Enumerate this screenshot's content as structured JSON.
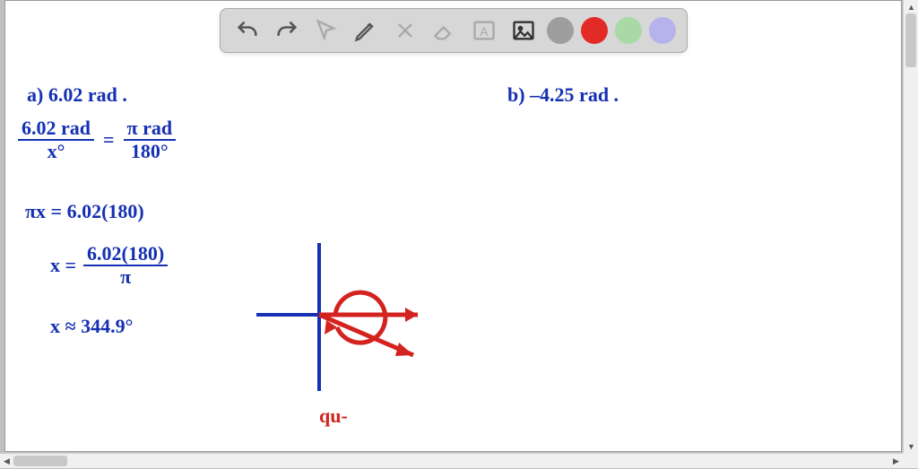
{
  "toolbar": {
    "tools": [
      "undo",
      "redo",
      "pointer",
      "pencil",
      "tools-crossed",
      "eraser",
      "text-box",
      "image",
      "color-gray",
      "color-red",
      "color-green",
      "color-purple"
    ]
  },
  "colors": {
    "gray": "#9e9e9e",
    "red": "#e22b26",
    "green": "#a9d9a5",
    "purple": "#b6b3ec",
    "ink_blue": "#1530b3",
    "ink_red": "#d4221f"
  },
  "content": {
    "a_label": "a) 6.02 rad .",
    "b_label": "b) –4.25 rad .",
    "eq1_lhs_num": "6.02 rad",
    "eq1_lhs_den": "x°",
    "eq1_eqsign": "=",
    "eq1_rhs_num": "π rad",
    "eq1_rhs_den": "180°",
    "eq2": "πx = 6.02(180)",
    "eq3_lhs": "x =",
    "eq3_num": "6.02(180)",
    "eq3_den": "π",
    "eq4": "x ≈ 344.9°",
    "sketch_label": "qu-"
  }
}
